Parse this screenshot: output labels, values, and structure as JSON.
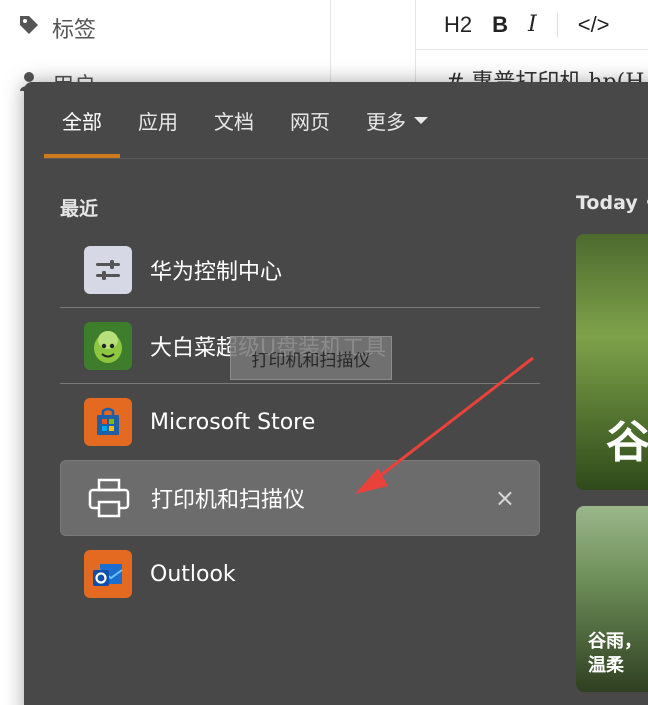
{
  "background": {
    "sidebar_items": [
      {
        "label": "标签",
        "icon": "tag-icon"
      },
      {
        "label": "用户",
        "icon": "user-icon"
      }
    ],
    "toolbar": {
      "h2": "H2",
      "bold": "B",
      "italic": "I",
      "code": "</>"
    },
    "editor_line": "# 惠普打印机 hp(H"
  },
  "flyout": {
    "tabs": [
      {
        "label": "全部",
        "active": true
      },
      {
        "label": "应用",
        "active": false
      },
      {
        "label": "文档",
        "active": false
      },
      {
        "label": "网页",
        "active": false
      },
      {
        "label": "更多",
        "active": false,
        "has_dropdown": true
      }
    ],
    "recent_title": "最近",
    "recent_items": [
      {
        "label": "华为控制中心",
        "icon": "sliders-icon"
      },
      {
        "label": "大白菜超级U盘装机工具",
        "icon": "cabbage-icon"
      },
      {
        "label": "Microsoft Store",
        "icon": "store-icon"
      },
      {
        "label": "打印机和扫描仪",
        "icon": "printer-icon",
        "selected": true,
        "close": "×"
      },
      {
        "label": "Outlook",
        "icon": "outlook-icon"
      }
    ],
    "tooltip": "打印机和扫描仪",
    "today_label": "Today •",
    "cards": [
      {
        "text": "谷"
      },
      {
        "text": "谷雨，",
        "text2": "温柔"
      }
    ],
    "accent_color": "#d07a1e",
    "annotation_arrow_color": "#e8423a"
  }
}
